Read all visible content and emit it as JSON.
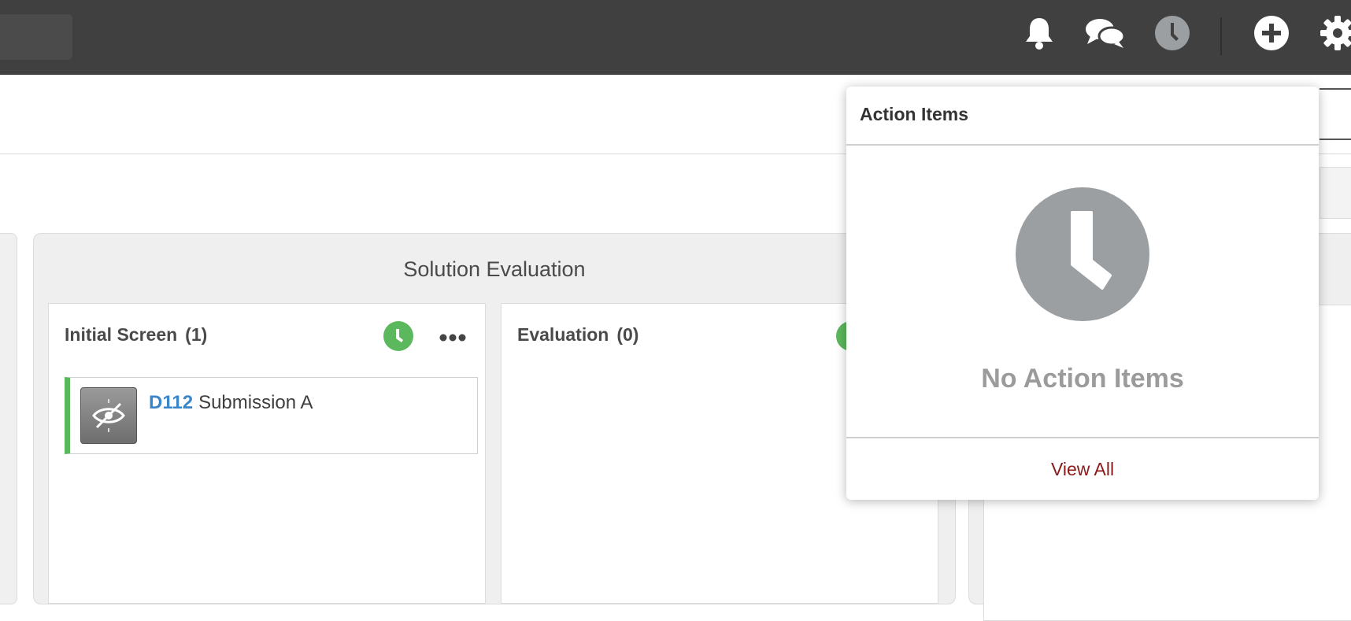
{
  "topbar": {
    "icons": [
      "bell-icon",
      "chat-icon",
      "clock-icon",
      "plus-circle-icon",
      "gear-icon"
    ],
    "colors": {
      "background": "#404040",
      "icon": "#ffffff",
      "active_icon": "#9b9fa1"
    }
  },
  "board": {
    "stage_title": "Solution Evaluation",
    "columns": [
      {
        "title": "Initial Screen",
        "count": "(1)",
        "cards": [
          {
            "id": "D112",
            "title": "Submission A",
            "thumb_icon": "hidden-idea-icon"
          }
        ]
      },
      {
        "title": "Evaluation",
        "count": "(0)",
        "cards": []
      }
    ],
    "colors": {
      "badge": "#5cb85c",
      "card_accent": "#5cb85c",
      "card_id": "#3a86c8"
    }
  },
  "popover": {
    "title": "Action Items",
    "empty_message": "No Action Items",
    "view_all": "View All",
    "colors": {
      "empty_icon": "#9b9fa1",
      "view_all": "#8b1a1a"
    }
  }
}
